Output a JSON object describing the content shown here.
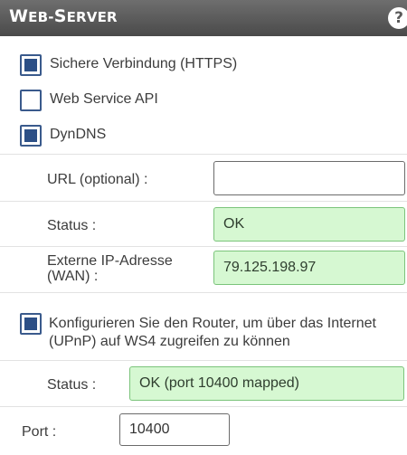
{
  "header": {
    "title_big": "W",
    "title_rest": "EB-S",
    "title_big2": "ERVER",
    "help_glyph": "?"
  },
  "options": {
    "https": {
      "label": "Sichere Verbindung (HTTPS)",
      "checked": true
    },
    "api": {
      "label": "Web Service API",
      "checked": false
    },
    "dyndns": {
      "label": "DynDNS",
      "checked": true
    }
  },
  "dyndns": {
    "url_label": "URL (optional) :",
    "url_value": "",
    "status_label": "Status :",
    "status_value": "OK",
    "ip_label": "Externe IP-Adresse (WAN) :",
    "ip_value": "79.125.198.97"
  },
  "upnp": {
    "label": "Konfigurieren Sie den Router, um über das Internet (UPnP) auf WS4 zugreifen zu können",
    "checked": true,
    "status_label": "Status :",
    "status_value": "OK (port 10400 mapped)"
  },
  "port": {
    "label": "Port :",
    "value": "10400"
  },
  "colors": {
    "accent": "#2c4f86",
    "ok_bg": "#d6f8d2",
    "header_bg": "#5c5c5c"
  }
}
